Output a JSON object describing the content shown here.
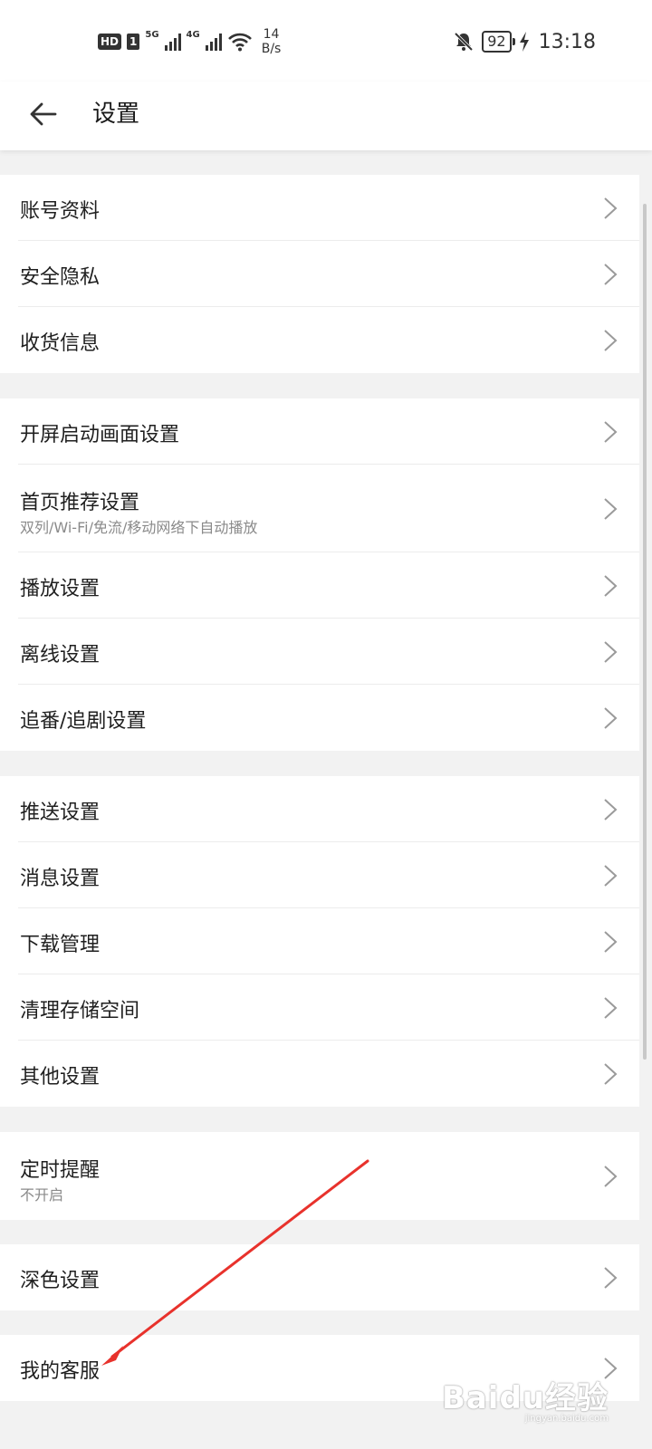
{
  "status_bar": {
    "hd": "HD",
    "sim": "1",
    "net1": "5G",
    "net2": "4G",
    "speed_value": "14",
    "speed_unit": "B/s",
    "battery": "92",
    "time": "13:18"
  },
  "header": {
    "title": "设置"
  },
  "groups": [
    {
      "items": [
        {
          "label": "账号资料"
        },
        {
          "label": "安全隐私"
        },
        {
          "label": "收货信息"
        }
      ]
    },
    {
      "items": [
        {
          "label": "开屏启动画面设置"
        },
        {
          "label": "首页推荐设置",
          "sub": "双列/Wi-Fi/免流/移动网络下自动播放"
        },
        {
          "label": "播放设置"
        },
        {
          "label": "离线设置"
        },
        {
          "label": "追番/追剧设置"
        }
      ]
    },
    {
      "items": [
        {
          "label": "推送设置"
        },
        {
          "label": "消息设置"
        },
        {
          "label": "下载管理"
        },
        {
          "label": "清理存储空间"
        },
        {
          "label": "其他设置"
        }
      ]
    },
    {
      "items": [
        {
          "label": "定时提醒",
          "sub": "不开启"
        }
      ]
    },
    {
      "items": [
        {
          "label": "深色设置"
        }
      ]
    },
    {
      "items": [
        {
          "label": "我的客服"
        }
      ]
    }
  ],
  "watermark": {
    "logo": "Baidu经验",
    "url": "jingyan.baidu.com"
  },
  "colors": {
    "background": "#f2f2f2",
    "surface": "#ffffff",
    "annotation_arrow": "#e8322c"
  }
}
